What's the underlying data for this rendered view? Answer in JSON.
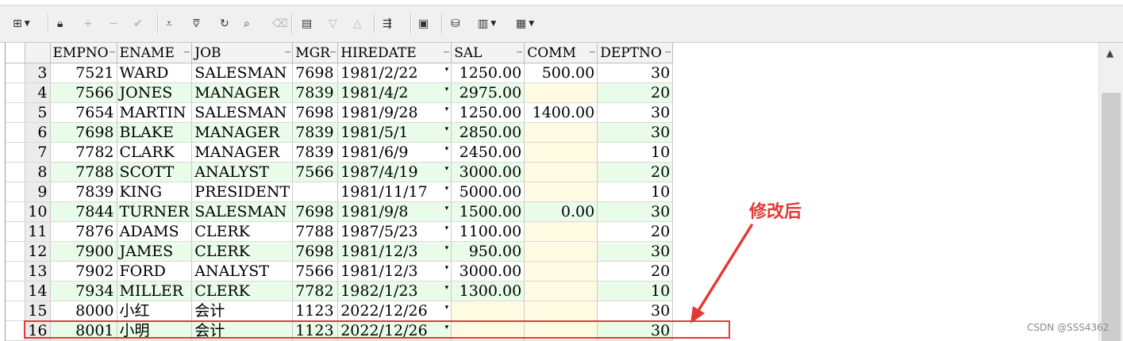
{
  "toolbar": {
    "items": [
      {
        "name": "grid-view-button",
        "glyph": "⊞",
        "dropdown": true
      },
      {
        "name": "lock-button",
        "glyph": "🔒︎"
      },
      {
        "name": "add-record-button",
        "glyph": "+",
        "disabled": true
      },
      {
        "name": "delete-record-button",
        "glyph": "−",
        "disabled": true
      },
      {
        "name": "post-changes-button",
        "glyph": "✔",
        "disabled": true
      },
      {
        "name": "fetch-next-button",
        "glyph": "⩡"
      },
      {
        "name": "fetch-all-button",
        "glyph": "⩢"
      },
      {
        "name": "refresh-button",
        "glyph": "↻"
      },
      {
        "name": "find-button",
        "glyph": "⌕"
      },
      {
        "name": "clear-button",
        "glyph": "⌫",
        "disabled": true
      },
      {
        "name": "query-by-example-button",
        "glyph": "▤"
      },
      {
        "name": "next-record-button",
        "glyph": "▽",
        "disabled": true
      },
      {
        "name": "previous-record-button",
        "glyph": "△",
        "disabled": true
      },
      {
        "name": "single-record-view-button",
        "glyph": "⇶"
      },
      {
        "name": "save-button",
        "glyph": "▣"
      },
      {
        "name": "export-button",
        "glyph": "⛁"
      },
      {
        "name": "chart-button",
        "glyph": "▥",
        "dropdown": true
      },
      {
        "name": "table-grid-button",
        "glyph": "▦",
        "dropdown": true
      }
    ]
  },
  "columns": [
    "EMPNO",
    "ENAME",
    "JOB",
    "MGR",
    "HIREDATE",
    "SAL",
    "COMM",
    "DEPTNO"
  ],
  "rows": [
    {
      "rownum": "3",
      "empno": "7521",
      "ename": "WARD",
      "job": "SALESMAN",
      "mgr": "7698",
      "hiredate": "1981/2/22",
      "sal": "1250.00",
      "comm": "500.00",
      "deptno": "30"
    },
    {
      "rownum": "4",
      "empno": "7566",
      "ename": "JONES",
      "job": "MANAGER",
      "mgr": "7839",
      "hiredate": "1981/4/2",
      "sal": "2975.00",
      "comm": "",
      "deptno": "20"
    },
    {
      "rownum": "5",
      "empno": "7654",
      "ename": "MARTIN",
      "job": "SALESMAN",
      "mgr": "7698",
      "hiredate": "1981/9/28",
      "sal": "1250.00",
      "comm": "1400.00",
      "deptno": "30"
    },
    {
      "rownum": "6",
      "empno": "7698",
      "ename": "BLAKE",
      "job": "MANAGER",
      "mgr": "7839",
      "hiredate": "1981/5/1",
      "sal": "2850.00",
      "comm": "",
      "deptno": "30"
    },
    {
      "rownum": "7",
      "empno": "7782",
      "ename": "CLARK",
      "job": "MANAGER",
      "mgr": "7839",
      "hiredate": "1981/6/9",
      "sal": "2450.00",
      "comm": "",
      "deptno": "10"
    },
    {
      "rownum": "8",
      "empno": "7788",
      "ename": "SCOTT",
      "job": "ANALYST",
      "mgr": "7566",
      "hiredate": "1987/4/19",
      "sal": "3000.00",
      "comm": "",
      "deptno": "20"
    },
    {
      "rownum": "9",
      "empno": "7839",
      "ename": "KING",
      "job": "PRESIDENT",
      "mgr": "",
      "hiredate": "1981/11/17",
      "sal": "5000.00",
      "comm": "",
      "deptno": "10"
    },
    {
      "rownum": "10",
      "empno": "7844",
      "ename": "TURNER",
      "job": "SALESMAN",
      "mgr": "7698",
      "hiredate": "1981/9/8",
      "sal": "1500.00",
      "comm": "0.00",
      "deptno": "30"
    },
    {
      "rownum": "11",
      "empno": "7876",
      "ename": "ADAMS",
      "job": "CLERK",
      "mgr": "7788",
      "hiredate": "1987/5/23",
      "sal": "1100.00",
      "comm": "",
      "deptno": "20"
    },
    {
      "rownum": "12",
      "empno": "7900",
      "ename": "JAMES",
      "job": "CLERK",
      "mgr": "7698",
      "hiredate": "1981/12/3",
      "sal": "950.00",
      "comm": "",
      "deptno": "30"
    },
    {
      "rownum": "13",
      "empno": "7902",
      "ename": "FORD",
      "job": "ANALYST",
      "mgr": "7566",
      "hiredate": "1981/12/3",
      "sal": "3000.00",
      "comm": "",
      "deptno": "20"
    },
    {
      "rownum": "14",
      "empno": "7934",
      "ename": "MILLER",
      "job": "CLERK",
      "mgr": "7782",
      "hiredate": "1982/1/23",
      "sal": "1300.00",
      "comm": "",
      "deptno": "10"
    },
    {
      "rownum": "15",
      "empno": "8000",
      "ename": "小红",
      "job": "会计",
      "mgr": "1123",
      "hiredate": "2022/12/26",
      "sal": "",
      "comm": "",
      "deptno": "30"
    },
    {
      "rownum": "16",
      "empno": "8001",
      "ename": "小明",
      "job": "会计",
      "mgr": "1123",
      "hiredate": "2022/12/26",
      "sal": "",
      "comm": "",
      "deptno": "30"
    }
  ],
  "annotation": {
    "label": "修改后",
    "color": "#e53935"
  },
  "watermark": "CSDN @SSS4362",
  "colors": {
    "row_green": "#e9fbe9",
    "comm_empty": "#fffbe3",
    "highlight": "#e53935"
  }
}
